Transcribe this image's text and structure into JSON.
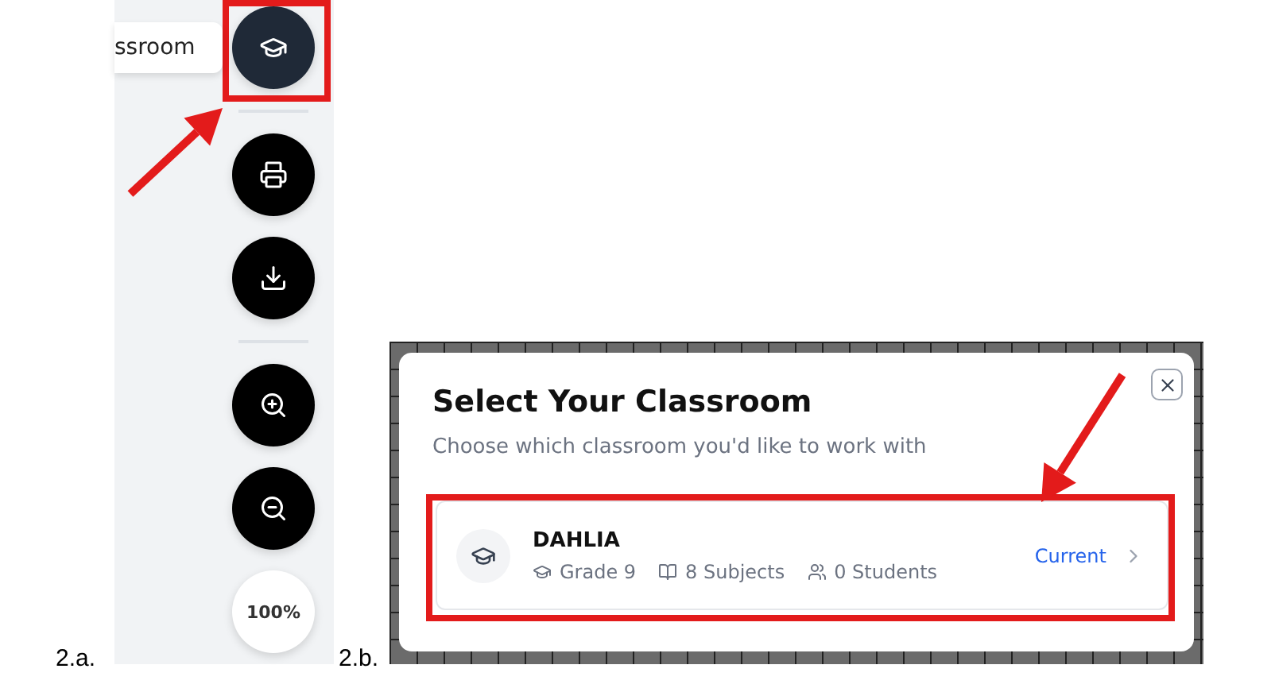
{
  "figure_a": {
    "label": "2.a.",
    "tooltip": "ssroom",
    "toolbar": [
      {
        "kind": "classroom",
        "highlighted": true
      },
      {
        "kind": "divider"
      },
      {
        "kind": "print",
        "highlighted": false
      },
      {
        "kind": "download",
        "highlighted": false
      },
      {
        "kind": "divider"
      },
      {
        "kind": "zoom_in",
        "highlighted": false
      },
      {
        "kind": "zoom_out",
        "highlighted": false
      },
      {
        "kind": "zoom_level",
        "text": "100%",
        "highlighted": false
      }
    ]
  },
  "figure_b": {
    "label": "2.b.",
    "dialog": {
      "title": "Select Your Classroom",
      "subtitle": "Choose which classroom you'd like to work with",
      "classrooms": [
        {
          "name": "DAHLIA",
          "grade": "Grade 9",
          "subjects": "8 Subjects",
          "students": "0 Students",
          "status": "Current",
          "highlighted": true
        }
      ]
    }
  }
}
